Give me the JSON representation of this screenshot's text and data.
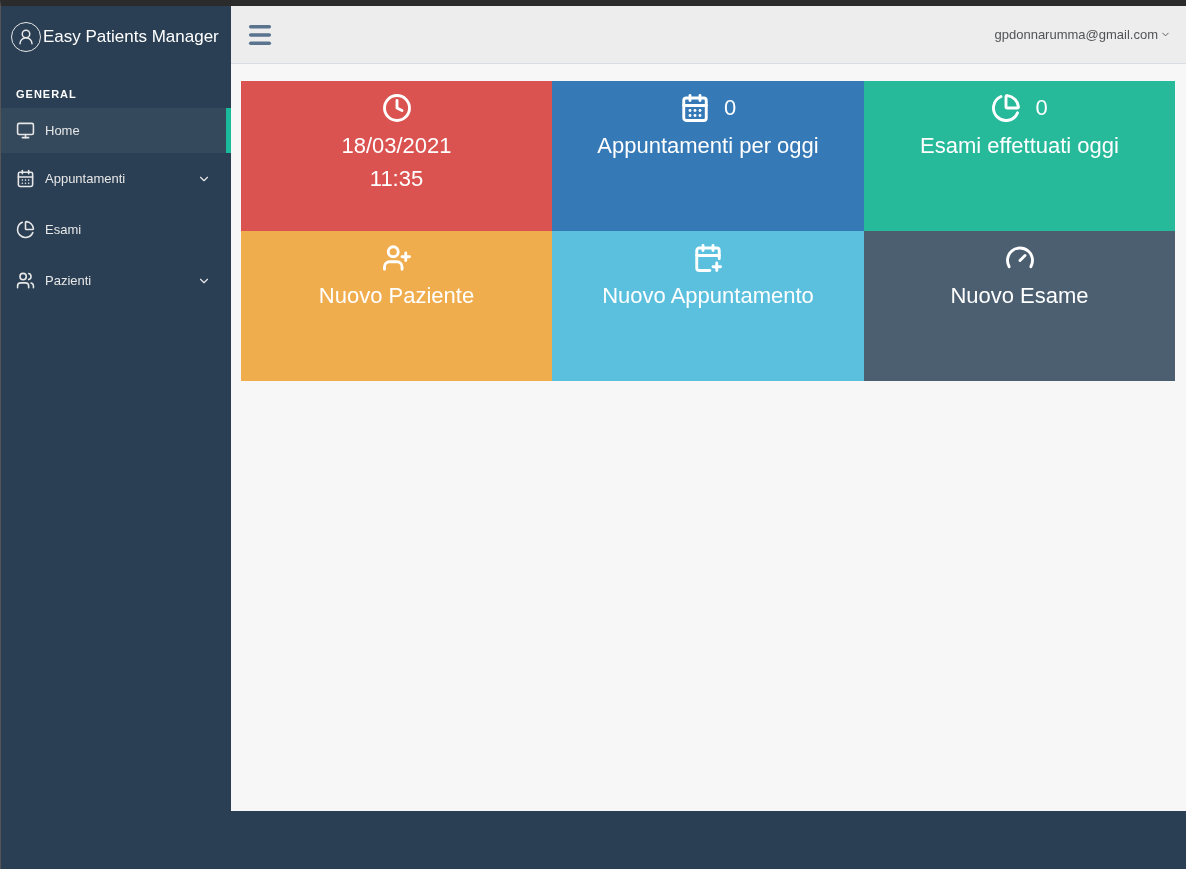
{
  "app": {
    "title": "Easy Patients Manager"
  },
  "sidebar": {
    "section": "GENERAL",
    "items": [
      {
        "label": "Home",
        "selected": true,
        "has_submenu": false
      },
      {
        "label": "Appuntamenti",
        "selected": false,
        "has_submenu": true
      },
      {
        "label": "Esami",
        "selected": false,
        "has_submenu": false
      },
      {
        "label": "Pazienti",
        "selected": false,
        "has_submenu": true
      }
    ]
  },
  "topbar": {
    "user": "gpdonnarumma@gmail.com"
  },
  "tiles": [
    {
      "color": "#da5350",
      "lines": [
        "18/03/2021",
        "11:35"
      ]
    },
    {
      "color": "#3579b6",
      "count": "0",
      "lines": [
        "Appuntamenti per oggi"
      ]
    },
    {
      "color": "#26b99a",
      "count": "0",
      "lines": [
        "Esami effettuati oggi"
      ]
    },
    {
      "color": "#f0ad4e",
      "lines": [
        "Nuovo Paziente"
      ]
    },
    {
      "color": "#5bc0de",
      "lines": [
        "Nuovo Appuntamento"
      ]
    },
    {
      "color": "#4b5f71",
      "lines": [
        "Nuovo Esame"
      ]
    }
  ]
}
